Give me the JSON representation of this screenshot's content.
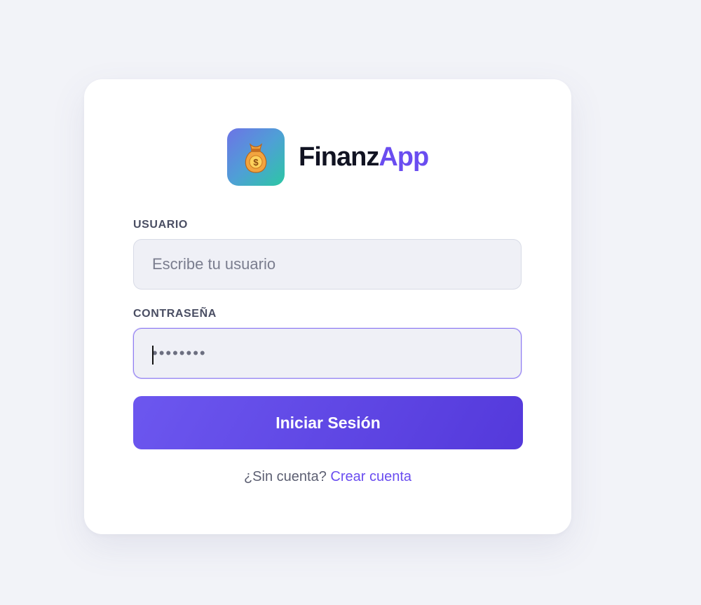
{
  "brand": {
    "name_part1": "Finanz",
    "name_part2": "App",
    "logo_icon": "money-bag-icon",
    "accent_color": "#6a4df0"
  },
  "form": {
    "username": {
      "label": "USUARIO",
      "placeholder": "Escribe tu usuario",
      "value": ""
    },
    "password": {
      "label": "CONTRASEÑA",
      "value": "••••••••"
    },
    "submit_label": "Iniciar Sesión"
  },
  "signup": {
    "prompt": "¿Sin cuenta?",
    "link_label": "Crear cuenta"
  }
}
